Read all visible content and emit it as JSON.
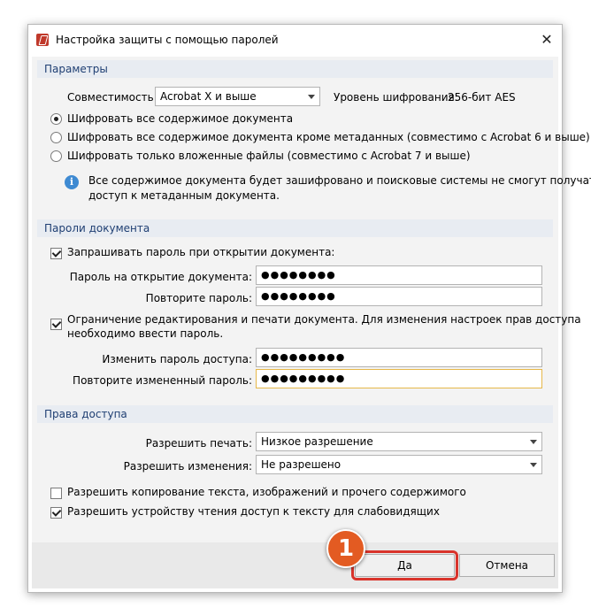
{
  "window": {
    "title": "Настройка защиты с помощью паролей",
    "close_glyph": "✕"
  },
  "params": {
    "header": "Параметры",
    "compat_label": "Совместимость:",
    "compat_value": "Acrobat X и выше",
    "encryption_label": "Уровень шифрования:",
    "encryption_value": "256-бит AES",
    "radios": [
      {
        "label": "Шифровать все содержимое документа",
        "selected": true
      },
      {
        "label": "Шифровать все содержимое документа кроме метаданных (совместимо с Acrobat 6 и выше)",
        "selected": false
      },
      {
        "label": "Шифровать только вложенные файлы (совместимо с Acrobat 7 и выше)",
        "selected": false
      }
    ],
    "info_line1": "Все содержимое документа будет зашифровано и поисковые системы не смогут получать",
    "info_line2": "доступ к метаданным документа."
  },
  "passwords": {
    "header": "Пароли документа",
    "require_open": {
      "label": "Запрашивать пароль при открытии документа:",
      "checked": true
    },
    "open_label": "Пароль на открытие документа:",
    "open_value": "●●●●●●●●",
    "repeat_label": "Повторите пароль:",
    "repeat_value": "●●●●●●●●",
    "restrict": {
      "label_line1": "Ограничение редактирования и печати документа.  Для изменения настроек прав доступа",
      "label_line2": "необходимо ввести пароль.",
      "checked": true
    },
    "change_label": "Изменить пароль доступа:",
    "change_value": "●●●●●●●●●",
    "repeat_change_label": "Повторите измененный пароль:",
    "repeat_change_value": "●●●●●●●●●"
  },
  "rights": {
    "header": "Права доступа",
    "print_label": "Разрешить печать:",
    "print_value": "Низкое разрешение",
    "changes_label": "Разрешить изменения:",
    "changes_value": "Не разрешено",
    "copy": {
      "label": "Разрешить копирование текста, изображений и прочего содержимого",
      "checked": false
    },
    "reader": {
      "label": "Разрешить устройству чтения доступ к тексту для слабовидящих",
      "checked": true
    }
  },
  "buttons": {
    "ok": "Да",
    "cancel": "Отмена"
  },
  "annotation": {
    "step": "1"
  },
  "colors": {
    "badge": "#e35b22",
    "highlight": "#d9332b",
    "group_header": "#e8ecf2",
    "info": "#3e8ad2"
  }
}
